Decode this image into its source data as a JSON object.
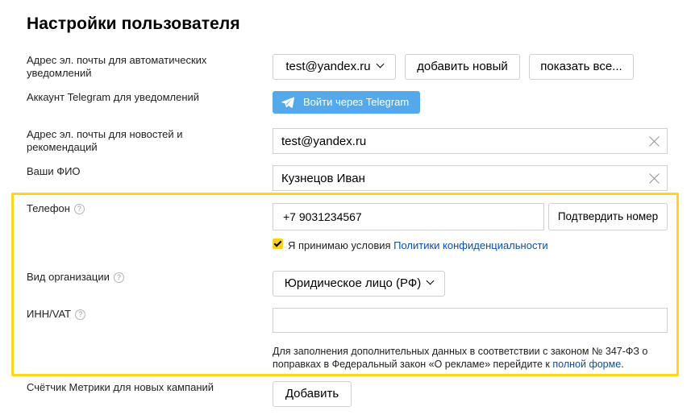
{
  "page": {
    "title": "Настройки пользователя"
  },
  "notify_email": {
    "label": "Адрес эл. почты для автоматических уведомлений",
    "selected": "test@yandex.ru",
    "add_label": "добавить новый",
    "show_all_label": "показать все..."
  },
  "telegram": {
    "label": "Аккаунт Telegram для уведомлений",
    "button_label": "Войти через Telegram",
    "icon": "telegram-icon",
    "color": "#54a9eb"
  },
  "news_email": {
    "label": "Адрес эл. почты для новостей и рекомендаций",
    "value": "test@yandex.ru"
  },
  "full_name": {
    "label": "Ваши ФИО",
    "value": "Кузнецов Иван"
  },
  "phone": {
    "label": "Телефон",
    "value": "+7 9031234567",
    "confirm_label": "Подтвердить номер"
  },
  "privacy": {
    "checked": true,
    "text": "Я принимаю условия ",
    "link": "Политики конфиденциальности"
  },
  "org_type": {
    "label": "Вид организации",
    "selected": "Юридическое лицо (РФ)"
  },
  "inn": {
    "label": "ИНН/VAT",
    "value": ""
  },
  "note": {
    "text": "Для заполнения дополнительных данных в соответствии с законом № 347-ФЗ о поправках в Федеральный закон «О рекламе» перейдите к ",
    "link": "полной форме",
    "end": "."
  },
  "metrika": {
    "label": "Счётчик Метрики для новых кампаний",
    "add_label": "Добавить"
  },
  "help_glyph": "?",
  "colors": {
    "highlight": "#fcd61c",
    "checkbox": "#fdd020",
    "link": "#0a50a0"
  }
}
